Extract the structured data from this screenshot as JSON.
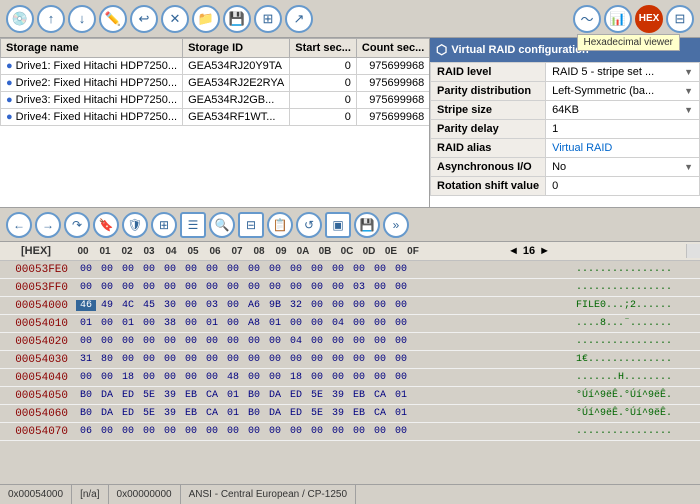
{
  "toolbar": {
    "tooltip": "Hexadecimal viewer"
  },
  "storage": {
    "columns": [
      "Storage name",
      "Storage ID",
      "Start sec...",
      "Count sec..."
    ],
    "rows": [
      {
        "name": "Drive1: Fixed Hitachi HDP7250...",
        "id": "GEA534RJ20Y9TA",
        "start": "0",
        "count": "975699968"
      },
      {
        "name": "Drive2: Fixed Hitachi HDP7250...",
        "id": "GEA534RJ2E2RYA",
        "start": "0",
        "count": "975699968"
      },
      {
        "name": "Drive3: Fixed Hitachi HDP7250...",
        "id": "GEA534RJ2GB...",
        "start": "0",
        "count": "975699968"
      },
      {
        "name": "Drive4: Fixed Hitachi HDP7250...",
        "id": "GEA534RF1WT...",
        "start": "0",
        "count": "975699968"
      }
    ]
  },
  "raid": {
    "header": "Virtual RAID configuration",
    "rows": [
      {
        "label": "RAID level",
        "value": "RAID 5 - stripe set ...",
        "dropdown": true
      },
      {
        "label": "Parity distribution",
        "value": "Left-Symmetric (ba...",
        "dropdown": true
      },
      {
        "label": "Stripe size",
        "value": "64KB",
        "dropdown": true
      },
      {
        "label": "Parity delay",
        "value": "1"
      },
      {
        "label": "RAID alias",
        "value": "Virtual RAID",
        "link": true
      },
      {
        "label": "Asynchronous I/O",
        "value": "No",
        "dropdown": true
      },
      {
        "label": "Rotation shift value",
        "value": "0"
      }
    ]
  },
  "hex": {
    "page_label": "16",
    "header_bytes": [
      "00",
      "01",
      "02",
      "03",
      "04",
      "05",
      "06",
      "07",
      "08",
      "09",
      "0A",
      "0B",
      "0C",
      "0D",
      "0E",
      "0F"
    ],
    "rows": [
      {
        "addr": "00053FE0",
        "bytes": "00 00 00 00 00 00 00 00 00 00 00 00 00 00 00 00",
        "ascii": "................"
      },
      {
        "addr": "00053FF0",
        "bytes": "00 00 00 00 00 00 00 00 00 00 00 00 00 03 00 00",
        "ascii": "................"
      },
      {
        "addr": "00054000",
        "bytes": "46 49 4C 45 30 00 03 00 A6 9B 32 00 00 00 00 00",
        "ascii": "FILE0...;2......",
        "highlight_first": true
      },
      {
        "addr": "00054010",
        "bytes": "01 00 01 00 38 00 01 00 A8 01 00 00 04 00 00 00",
        "ascii": "....8...¨.......",
        "partial": true
      },
      {
        "addr": "00054020",
        "bytes": "00 00 00 00 00 00 00 00 00 00 04 00 00 00 00 00",
        "ascii": "................"
      },
      {
        "addr": "00054030",
        "bytes": "31 80 00 00 00 00 00 00 00 00 00 00 00 00 00 00",
        "ascii": "1€.............."
      },
      {
        "addr": "00054040",
        "bytes": "00 00 18 00 00 00 00 48 00 00 18 00 00 00 00 00",
        "ascii": ".......H........"
      },
      {
        "addr": "00054050",
        "bytes": "B0 DA ED 5E 39 EB CA 01 B0 DA ED 5E 39 EB CA 01",
        "ascii": "°Úí^9ëÊ.°Úí^9ëÊ."
      },
      {
        "addr": "00054060",
        "bytes": "B0 DA ED 5E 39 EB CA 01 B0 DA ED 5E 39 EB CA 01",
        "ascii": "°Úí^9ëÊ.°Úí^9ëÊ."
      },
      {
        "addr": "00054070",
        "bytes": "06 00 00 00 00 00 00 00 00 00 00 00 00 00 00 00",
        "ascii": "................"
      }
    ]
  },
  "statusbar": {
    "offset": "0x00054000",
    "na": "[n/a]",
    "hex_offset": "0x00000000",
    "encoding": "ANSI - Central European / CP-1250"
  }
}
